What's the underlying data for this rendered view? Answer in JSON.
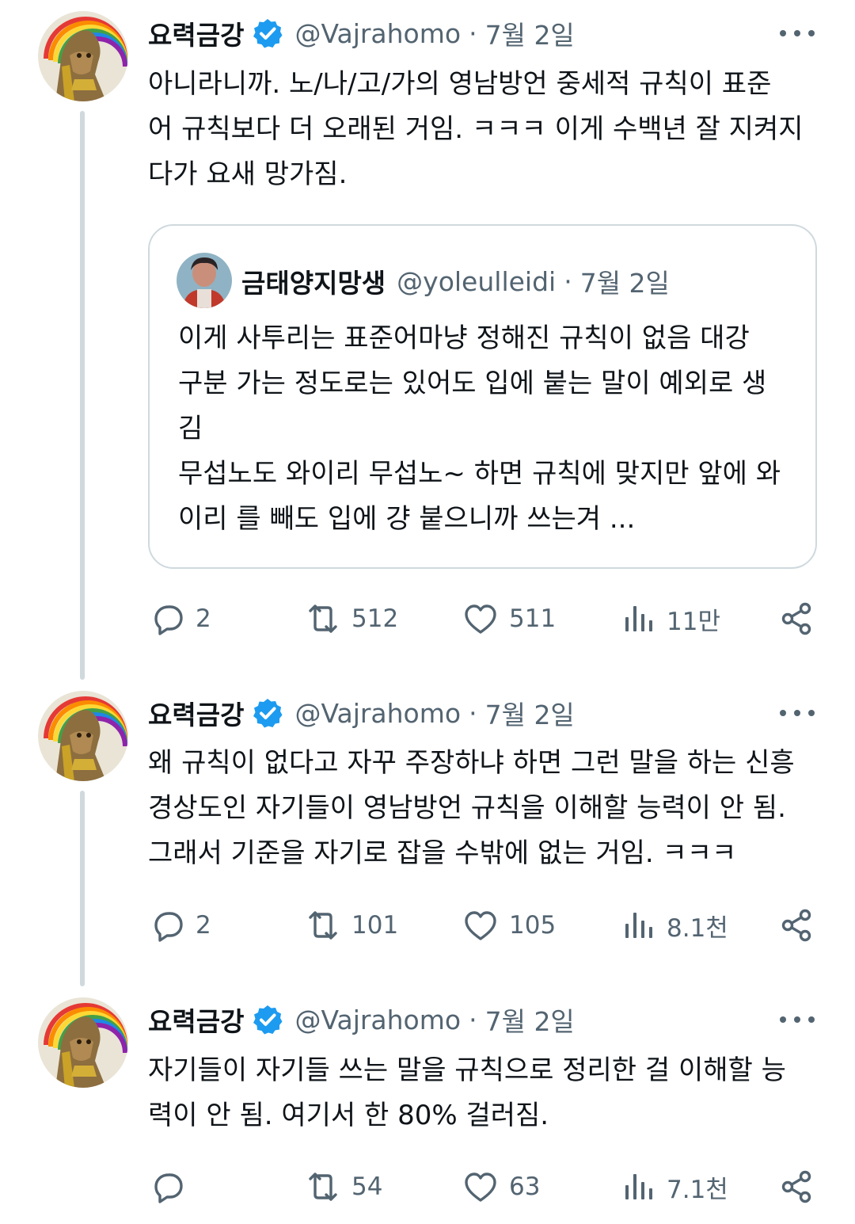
{
  "colors": {
    "text": "#0f1419",
    "secondary": "#536471",
    "verified": "#1d9bf0",
    "border": "#cfd9de"
  },
  "tweets": [
    {
      "author": {
        "name": "요력금강",
        "handle": "@Vajrahomo",
        "date": "7월 2일",
        "avatar_icon": "rainbow-lioness-avatar",
        "verified": true
      },
      "text_lines": [
        "아니라니까. 노/나/고/가의 영남방언 중세적 규칙이 표준",
        "어 규칙보다 더 오래된 거임. ㅋㅋㅋ 이게 수백년 잘 지켜지",
        "다가 요새 망가짐."
      ],
      "quote": {
        "author": {
          "name": "금태양지망생",
          "handle": "@yoleulleidi",
          "date": "7월 2일",
          "avatar_icon": "person-avatar"
        },
        "text_lines": [
          "이게 사투리는 표준어마냥 정해진 규칙이 없음 대강",
          "구분 가는 정도로는 있어도 입에 붙는 말이 예외로 생",
          "김",
          "무섭노도 와이리 무섭노~ 하면 규칙에 맞지만 앞에 와",
          "이리 를 빼도 입에 걍 붙으니까 쓰는겨 ..."
        ]
      },
      "stats": {
        "replies": "2",
        "retweets": "512",
        "likes": "511",
        "views": "11만"
      }
    },
    {
      "author": {
        "name": "요력금강",
        "handle": "@Vajrahomo",
        "date": "7월 2일",
        "avatar_icon": "rainbow-lioness-avatar",
        "verified": true
      },
      "text_lines": [
        "왜 규칙이 없다고 자꾸 주장하냐 하면 그런 말을 하는 신흥",
        "경상도인 자기들이 영남방언 규칙을 이해할 능력이 안 됨.",
        "그래서 기준을 자기로 잡을 수밖에 없는 거임. ㅋㅋㅋ"
      ],
      "stats": {
        "replies": "2",
        "retweets": "101",
        "likes": "105",
        "views": "8.1천"
      }
    },
    {
      "author": {
        "name": "요력금강",
        "handle": "@Vajrahomo",
        "date": "7월 2일",
        "avatar_icon": "rainbow-lioness-avatar",
        "verified": true
      },
      "text_lines": [
        "자기들이 자기들 쓰는 말을 규칙으로 정리한 걸 이해할 능",
        "력이 안 됨. 여기서 한 80% 걸러짐."
      ],
      "stats": {
        "replies": "",
        "retweets": "54",
        "likes": "63",
        "views": "7.1천"
      }
    }
  ]
}
